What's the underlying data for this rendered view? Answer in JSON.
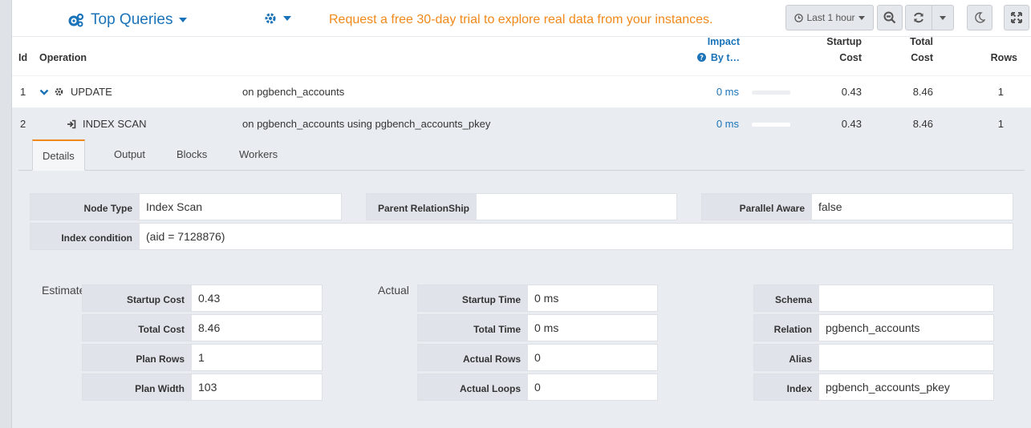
{
  "topbar": {
    "title": "Top Queries",
    "trial_message": "Request a free 30-day trial to explore real data from your instances.",
    "time_range": "Last 1 hour"
  },
  "table": {
    "headers": {
      "id": "Id",
      "operation": "Operation",
      "impact": "Impact",
      "impact_sub": "By t…",
      "startup_cost_1": "Startup",
      "startup_cost_2": "Cost",
      "total_cost_1": "Total",
      "total_cost_2": "Cost",
      "rows": "Rows"
    },
    "rows": [
      {
        "id": "1",
        "operation": "UPDATE",
        "target": "on pgbench_accounts",
        "impact": "0 ms",
        "startup_cost": "0.43",
        "total_cost": "8.46",
        "rows": "1"
      },
      {
        "id": "2",
        "operation": "INDEX SCAN",
        "target": "on pgbench_accounts using pgbench_accounts_pkey",
        "impact": "0 ms",
        "startup_cost": "0.43",
        "total_cost": "8.46",
        "rows": "1"
      }
    ]
  },
  "tabs": [
    "Details",
    "Output",
    "Blocks",
    "Workers"
  ],
  "details": {
    "node_type_label": "Node Type",
    "node_type": "Index Scan",
    "parent_rel_label": "Parent RelationShip",
    "parent_rel": "",
    "parallel_label": "Parallel Aware",
    "parallel": "false",
    "index_cond_label": "Index condition",
    "index_cond": "(aid = 7128876)"
  },
  "estimate": {
    "label": "Estimate",
    "startup_cost_label": "Startup Cost",
    "startup_cost": "0.43",
    "total_cost_label": "Total Cost",
    "total_cost": "8.46",
    "plan_rows_label": "Plan Rows",
    "plan_rows": "1",
    "plan_width_label": "Plan Width",
    "plan_width": "103"
  },
  "actual": {
    "label": "Actual",
    "startup_time_label": "Startup Time",
    "startup_time": "0 ms",
    "total_time_label": "Total Time",
    "total_time": "0 ms",
    "actual_rows_label": "Actual Rows",
    "actual_rows": "0",
    "actual_loops_label": "Actual Loops",
    "actual_loops": "0"
  },
  "relation": {
    "schema_label": "Schema",
    "schema": "",
    "relation_label": "Relation",
    "relation": "pgbench_accounts",
    "alias_label": "Alias",
    "alias": "",
    "index_label": "Index",
    "index": "pgbench_accounts_pkey"
  },
  "colors": {
    "accent_blue": "#1a73b8",
    "accent_orange": "#f0891a"
  }
}
